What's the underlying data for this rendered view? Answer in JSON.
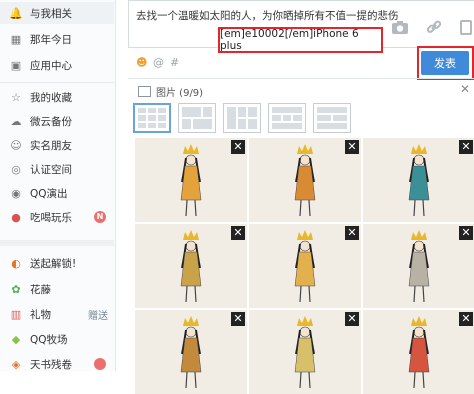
{
  "sidebar": {
    "items": [
      {
        "label": "与我相关",
        "icon": "bell-icon",
        "active": true
      },
      {
        "label": "那年今日",
        "icon": "calendar-icon"
      },
      {
        "label": "应用中心",
        "icon": "apps-grid-icon"
      },
      {
        "label": "我的收藏",
        "icon": "star-icon"
      },
      {
        "label": "微云备份",
        "icon": "cloud-icon"
      },
      {
        "label": "实名朋友",
        "icon": "friends-icon"
      },
      {
        "label": "认证空间",
        "icon": "verified-icon"
      },
      {
        "label": "QQ演出",
        "icon": "ticket-icon"
      },
      {
        "label": "吃喝玩乐",
        "icon": "food-icon",
        "badge": "N"
      },
      {
        "label": "送起解锁!",
        "icon": "unlock-icon"
      },
      {
        "label": "花藤",
        "icon": "flower-vine-icon"
      },
      {
        "label": "礼物",
        "icon": "gift-icon",
        "tag": "赠送"
      },
      {
        "label": "QQ牧场",
        "icon": "farm-icon"
      },
      {
        "label": "天书残卷",
        "icon": "book-icon"
      }
    ]
  },
  "composer": {
    "text": "去找一个温暖如太阳的人，为你晒掉所有不值一提的悲伤",
    "device_tag": "[em]e10002[/em]iPhone 6 plus",
    "publish_label": "发表",
    "toolbar_icons": [
      "emoji-icon",
      "at-icon",
      "hashtag-icon"
    ]
  },
  "image_panel": {
    "title": "图片 (9/9)",
    "layout_options": 5,
    "selected_layout": 0,
    "remove_label": "✕",
    "photos": [
      {
        "name": "illustration-1"
      },
      {
        "name": "illustration-2"
      },
      {
        "name": "illustration-3"
      },
      {
        "name": "illustration-4"
      },
      {
        "name": "illustration-5"
      },
      {
        "name": "illustration-6"
      },
      {
        "name": "illustration-7"
      },
      {
        "name": "illustration-8"
      },
      {
        "name": "illustration-9"
      }
    ]
  },
  "colors": {
    "accent": "#3f8bd9",
    "highlight": "#e1262c",
    "sidebar_bg": "#fafbfc"
  }
}
